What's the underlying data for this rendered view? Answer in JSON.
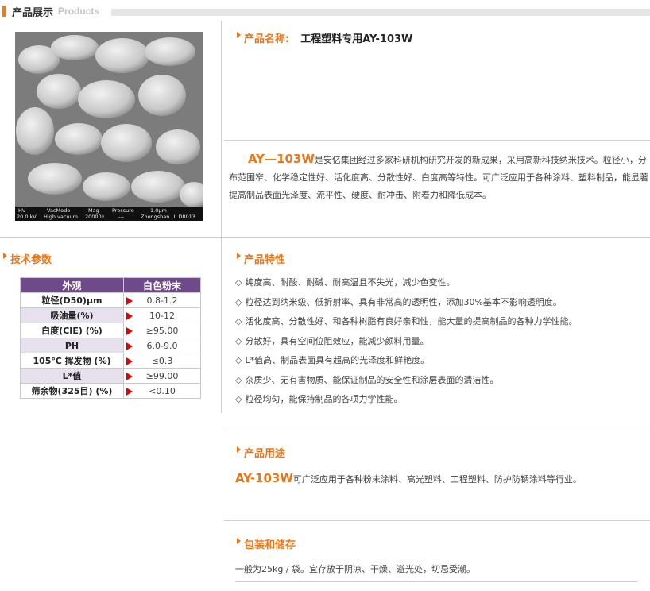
{
  "header": {
    "title_cn": "产品展示",
    "title_en": "Products"
  },
  "sem_image": {
    "hv": "HV",
    "hv_val": "20.0 kV",
    "mode": "VacMode",
    "mode_val": "High vacuum",
    "mag": "Mag",
    "mag_val": "20000x",
    "pressure": "Pressure",
    "pressure_val": "---",
    "scale": "1.0μm",
    "site": "Zhongshan U. D8013"
  },
  "product": {
    "name_label": "产品名称:",
    "name_value": "工程塑料专用AY-103W",
    "brand": "AY—103W",
    "description": "是安亿集团经过多家科研机构研究开发的新成果，采用高新科技纳米技术。粒径小，分布范围窄、化学稳定性好、活化度高、分散性好、白度高等特性。可广泛应用于各种涂料、塑料制品，能显著提高制品表面光泽度、流平性、硬度、耐冲击、附着力和降低成本。"
  },
  "specs": {
    "title": "技术参数",
    "header": [
      "外观",
      "白色粉末"
    ],
    "rows": [
      {
        "k": "粒径(D50)μm",
        "v": "0.8-1.2"
      },
      {
        "k": "吸油量(%)",
        "v": "10-12"
      },
      {
        "k": "白度(CIE) (%)",
        "v": "≥95.00"
      },
      {
        "k": "PH",
        "v": "6.0-9.0"
      },
      {
        "k": "105℃ 挥发物 (%)",
        "v": "≤0.3"
      },
      {
        "k": "L*值",
        "v": "≥99.00"
      },
      {
        "k": "筛余物(325目) (%)",
        "v": "<0.10"
      }
    ]
  },
  "features": {
    "title": "产品特性",
    "bullet": "◇",
    "items": [
      "纯度高、耐酸、耐碱、耐高温且不失光，减少色变性。",
      "粒径达到纳米级、低折射率、具有非常高的透明性，添加30%基本不影响透明度。",
      "活化度高、分散性好、和各种树脂有良好亲和性，能大量的提高制品的各种力学性能。",
      "分散好，具有空间位阻效应，能减少颜料用量。",
      "L*值高、制品表面具有超高的光泽度和鲜艳度。",
      "杂质少、无有害物质、能保证制品的安全性和涂层表面的清洁性。",
      "粒径均匀，能保持制品的各项力学性能。"
    ]
  },
  "usage": {
    "title": "产品用途",
    "brand": "AY-103W",
    "text": "可广泛应用于各种粉末涂料、高光塑料、工程塑料、防护防锈涂料等行业。"
  },
  "storage": {
    "title": "包装和储存",
    "text": "一般为25kg / 袋。宜存放于阴凉、干燥、避光处，切忌受潮。"
  },
  "colors": {
    "accent": "#e8761a",
    "table_header": "#6e4a8a",
    "marker": "#e30000"
  }
}
